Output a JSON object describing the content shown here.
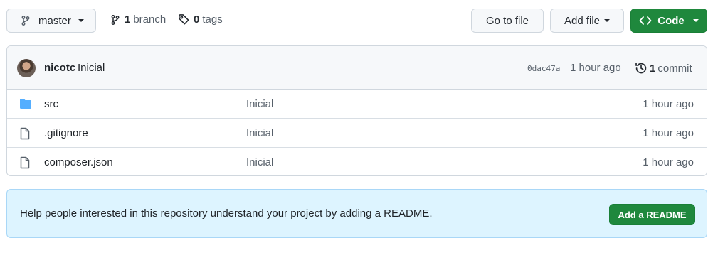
{
  "toolbar": {
    "branch_label": "master",
    "branches_count": "1",
    "branches_word": "branch",
    "tags_count": "0",
    "tags_word": "tags",
    "goto_label": "Go to file",
    "addfile_label": "Add file",
    "code_label": "Code"
  },
  "commit": {
    "author": "nicotc",
    "message": "Inicial",
    "sha": "0dac47a",
    "time": "1 hour ago",
    "commits_count": "1",
    "commits_word": "commit"
  },
  "files": [
    {
      "name": "src",
      "type": "folder",
      "icon": "folder-icon",
      "commit": "Inicial",
      "age": "1 hour ago"
    },
    {
      "name": ".gitignore",
      "type": "file",
      "icon": "file-icon",
      "commit": "Inicial",
      "age": "1 hour ago"
    },
    {
      "name": "composer.json",
      "type": "file",
      "icon": "file-icon",
      "commit": "Inicial",
      "age": "1 hour ago"
    }
  ],
  "readme": {
    "text": "Help people interested in this repository understand your project by adding a README.",
    "button_label": "Add a README"
  },
  "colors": {
    "primary_green": "#1f883d",
    "folder_blue": "#54aeff",
    "banner_bg": "#ddf4ff",
    "muted_text": "#57606a"
  }
}
